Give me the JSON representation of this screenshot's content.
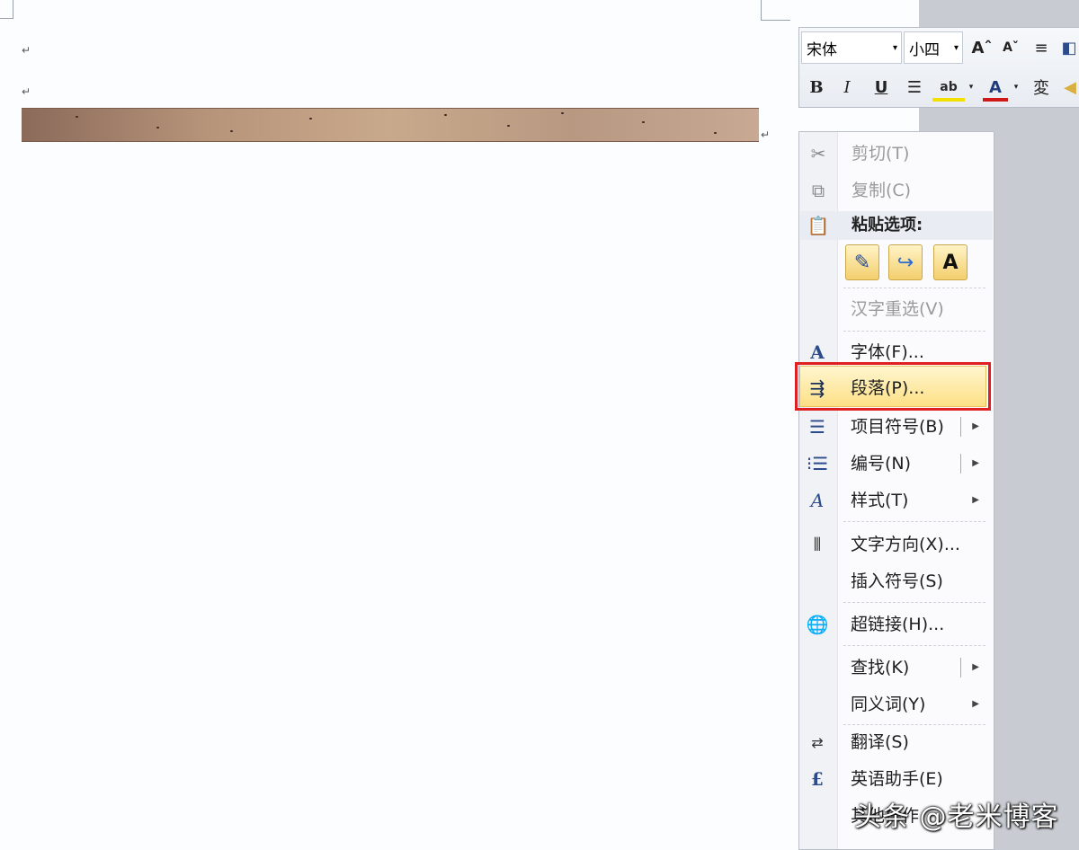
{
  "document": {
    "paragraph_mark": "↵"
  },
  "mini_toolbar": {
    "font_name": "宋体",
    "font_size": "小四",
    "bold": "B",
    "italic": "I",
    "underline": "U",
    "font_color": "A"
  },
  "context_menu": {
    "items": [
      {
        "label": "剪切(T)",
        "icon": "scissors-icon",
        "disabled": true
      },
      {
        "label": "复制(C)",
        "icon": "copy-icon",
        "disabled": true
      },
      {
        "label": "汉字重选(V)",
        "icon": "",
        "disabled": true
      },
      {
        "label": "字体(F)...",
        "icon": "font-icon"
      },
      {
        "label": "段落(P)...",
        "icon": "paragraph-icon",
        "highlighted": true
      },
      {
        "label": "项目符号(B)",
        "icon": "bullets-icon",
        "submenu": true
      },
      {
        "label": "编号(N)",
        "icon": "numbering-icon",
        "submenu": true
      },
      {
        "label": "样式(T)",
        "icon": "styles-icon",
        "submenu": true
      },
      {
        "label": "文字方向(X)...",
        "icon": "text-direction-icon"
      },
      {
        "label": "插入符号(S)",
        "icon": ""
      },
      {
        "label": "超链接(H)...",
        "icon": "hyperlink-icon"
      },
      {
        "label": "查找(K)",
        "icon": "",
        "submenu": true
      },
      {
        "label": "同义词(Y)",
        "icon": "",
        "submenu": true
      },
      {
        "label": "翻译(S)",
        "icon": "translate-icon"
      },
      {
        "label": "英语助手(E)",
        "icon": "english-assistant-icon"
      },
      {
        "label": "其他操作",
        "icon": ""
      }
    ],
    "paste_options_label": "粘贴选项:",
    "paste_text_only": "A"
  },
  "watermark": "头条 @老米博客",
  "colors": {
    "highlight_border": "#e02020",
    "highlight_fill": "#fde086",
    "font_color_red": "#d01818"
  }
}
